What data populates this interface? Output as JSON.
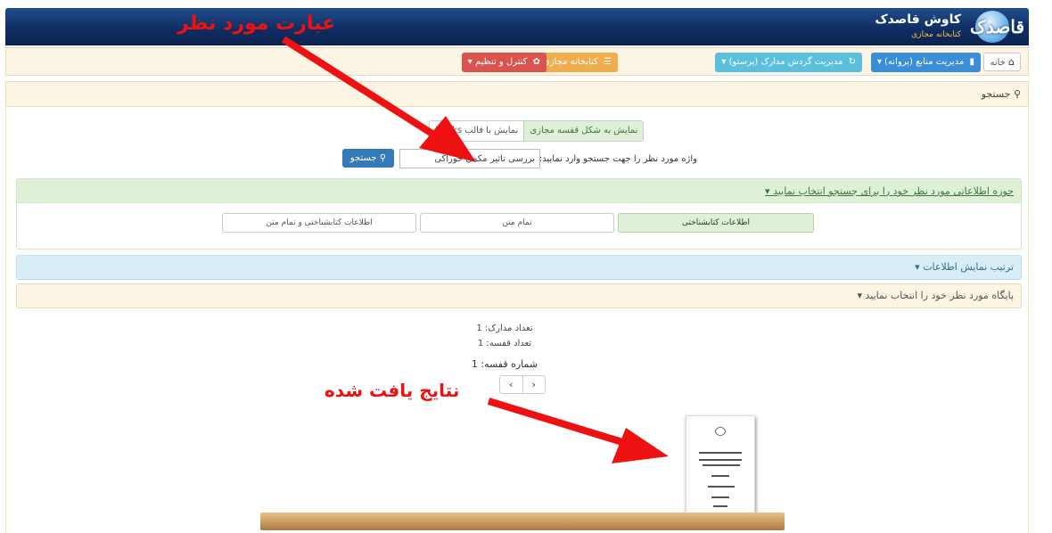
{
  "header": {
    "logo_text": "قاصدک",
    "title": "کاوش قاصدک",
    "subtitle": "کتابخانه مجازی"
  },
  "nav": {
    "home": "خانه",
    "items": [
      {
        "label": "مدیریت منابع (پروانه)",
        "icon": "book-icon",
        "color": "#3a8ed8"
      },
      {
        "label": "مدیریت گردش مدارک (پرستو)",
        "icon": "refresh-icon",
        "color": "#5bc0de"
      },
      {
        "label": "کتابخانه مجازی (قاصدک)",
        "icon": "list-icon",
        "color": "#5bc0de"
      },
      {
        "label": "کنترل و تنظیم",
        "icon": "gear-icon",
        "color": "#d9534f"
      }
    ],
    "caret": "▾"
  },
  "search_panel": {
    "title": "جستجو",
    "view_options": [
      "نمایش به شکل قفسه مجازی",
      "نمایش با قالب Books"
    ],
    "label": "واژه مورد نظر را جهت جستجو وارد نمایید:",
    "query": "بررسی تاثیر مکمل خوراکی",
    "button": "جستجو"
  },
  "scope": {
    "title": "حوزه اطلاعاتی مورد نظر خود را برای جستجو انتخاب نمایید",
    "options": [
      "اطلاعات کتابشناختی",
      "تمام متن",
      "اطلاعات کتابشناختی و تمام متن"
    ]
  },
  "sort_title": "ترتیب نمایش اطلاعات",
  "database_title": "پایگاه مورد نظر خود را انتخاب نمایید",
  "results": {
    "docs_count": "تعداد مدارک: 1",
    "shelves_count": "تعداد قفسه: 1",
    "shelf_number": "شماره قفسه: 1",
    "prev": "‹",
    "next": "›"
  },
  "annotations": {
    "search_term": "عبارت مورد نظر",
    "results_found": "نتایج یافت شده",
    "color": "#ee1111"
  }
}
